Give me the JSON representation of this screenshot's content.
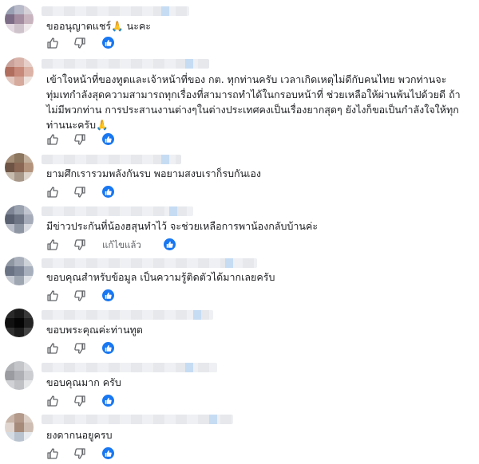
{
  "colors": {
    "accent": "#1877f2",
    "text": "#1c1e21",
    "muted": "#65676b"
  },
  "icons": {
    "like": "thumbs-up-icon",
    "dislike": "thumbs-down-icon",
    "reaction": "like-reaction-icon",
    "emoji": "folded-hands-emoji"
  },
  "comments": [
    {
      "lines": [
        "ขออนุญาตแชร์🙏 นะคะ"
      ],
      "edited_label": ""
    },
    {
      "lines": [
        "เข้าใจหน้าที่ของทูตและเจ้าหน้าที่ของ กต. ทุกท่านครับ เวลาเกิดเหตุไม่ดีกับคนไทย พวกท่านจะ",
        "ทุ่มเทกำลังสุดความสามารถทุกเรื่องที่สามารถทำได้ในกรอบหน้าที่ ช่วยเหลือให้ผ่านพ้นไปด้วยดี ถ้า",
        "ไม่มีพวกท่าน การประสานงานต่างๆในต่างประเทศคงเป็นเรื่องยากสุดๆ ยังไงก็ขอเป็นกำลังใจให้ทุก",
        "ท่านนะครับ🙏"
      ],
      "edited_label": ""
    },
    {
      "lines": [
        "ยามศึกเรารวมพลังกันรบ พอยามสงบเราก็รบกันเอง"
      ],
      "edited_label": ""
    },
    {
      "lines": [
        "มีข่าวประกันที่น้องฮสุนทำไว้ จะช่วยเหลือการพาน้องกลับบ้านค่ะ"
      ],
      "edited_label": "แก้ไขแล้ว"
    },
    {
      "lines": [
        "ขอบคุณสำหรับข้อมูล เป็นความรู้ติดตัวได้มากเลยครับ"
      ],
      "edited_label": ""
    },
    {
      "lines": [
        "ขอบพระคุณค่ะท่านทูต"
      ],
      "edited_label": ""
    },
    {
      "lines": [
        "ขอบคุณมาก ครับ"
      ],
      "edited_label": ""
    },
    {
      "lines": [
        "ยงดากนอยูครบ"
      ],
      "edited_label": ""
    }
  ]
}
